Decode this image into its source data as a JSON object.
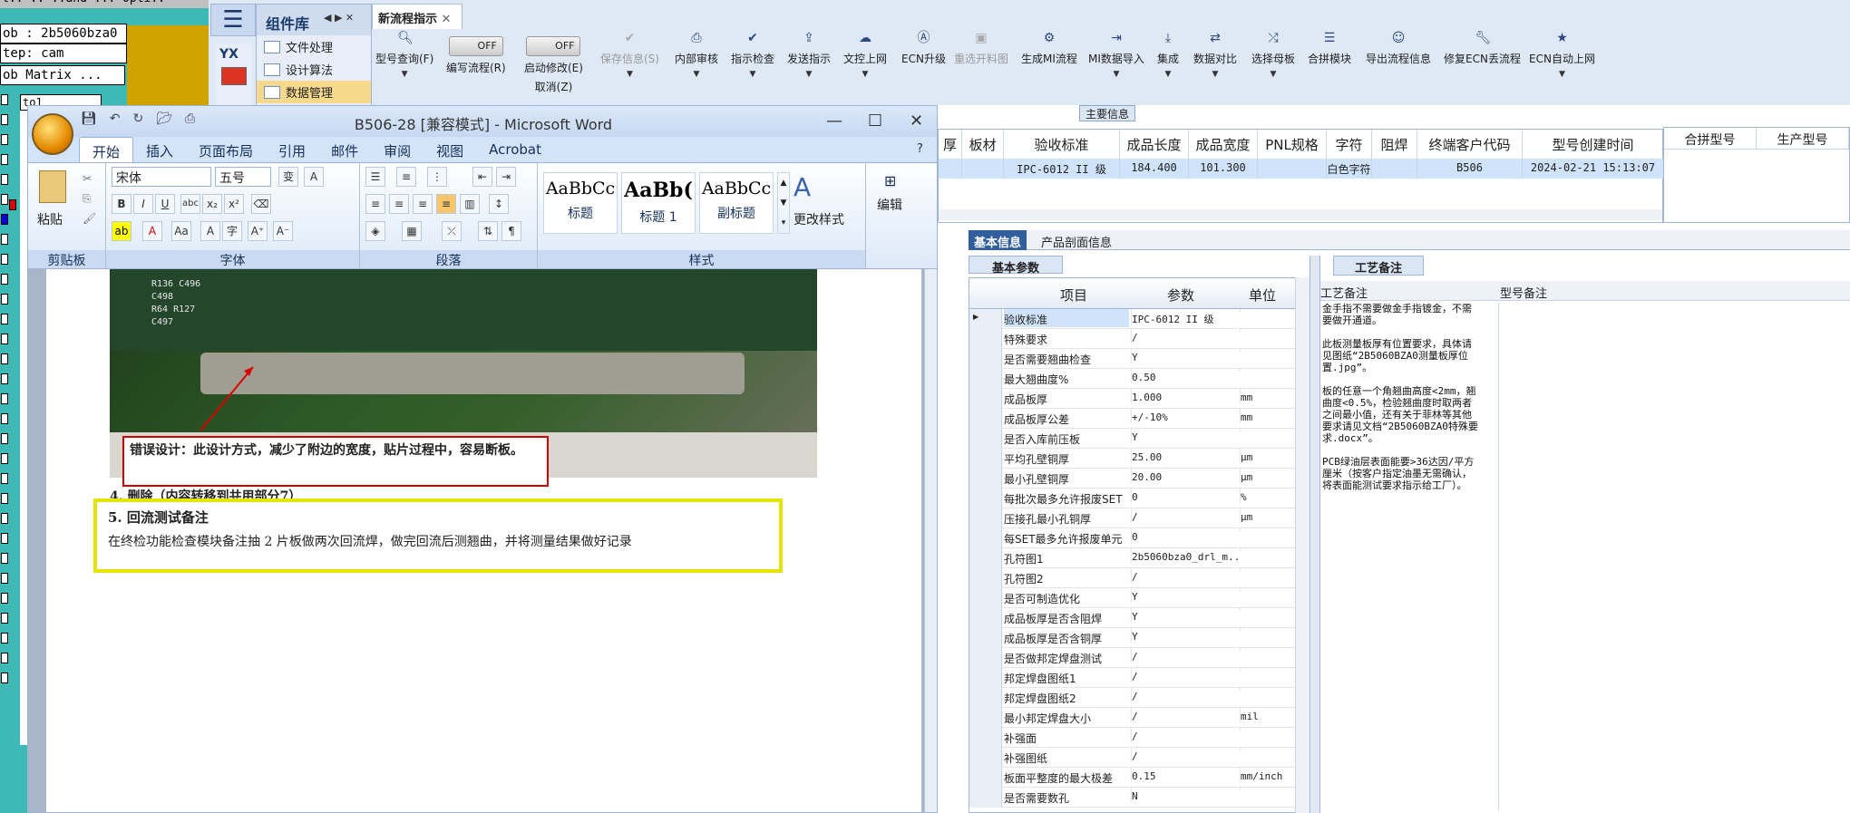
{
  "legacy": {
    "menu_text": "l.. .. ..and ... Opti..",
    "job_line": "ob : 2b5060bza0",
    "step_line": "tep: cam",
    "matrix_label": "ob Matrix ...",
    "row_label": "to1"
  },
  "app": {
    "library_title": "组件库",
    "library_items": [
      "文件处理",
      "设计算法",
      "数据管理"
    ],
    "active_tab": "新流程指示",
    "toolbar": [
      {
        "label": "型号查询(F)",
        "icon": "search-icon"
      },
      {
        "label": "编写流程(R)",
        "toggle": "OFF"
      },
      {
        "label": "启动修改(E)",
        "sub": "取消(Z)",
        "toggle": "OFF"
      },
      {
        "label": "保存信息(S)",
        "icon": "check-icon",
        "disabled": true
      },
      {
        "label": "内部审核",
        "icon": "print-icon"
      },
      {
        "label": "指示检查",
        "icon": "check-icon"
      },
      {
        "label": "发送指示",
        "icon": "upload-icon"
      },
      {
        "label": "文控上网",
        "icon": "cloud-icon"
      },
      {
        "label": "ECN升级",
        "icon": "a-icon"
      },
      {
        "label": "重选开料图",
        "icon": "image-icon",
        "disabled": true
      },
      {
        "label": "生成MI流程",
        "icon": "gears-icon"
      },
      {
        "label": "MI数据导入",
        "icon": "import-icon"
      },
      {
        "label": "集成",
        "icon": "download-icon"
      },
      {
        "label": "数据对比",
        "icon": "compare-icon"
      },
      {
        "label": "选择母板",
        "icon": "shuffle-icon"
      },
      {
        "label": "合拼模块",
        "icon": "list-icon"
      },
      {
        "label": "导出流程信息",
        "icon": "smile-icon"
      },
      {
        "label": "修复ECN丢流程",
        "icon": "wrench-icon"
      },
      {
        "label": "ECN自动上网",
        "icon": "star-icon"
      }
    ]
  },
  "word": {
    "title": "B506-28 [兼容模式] - Microsoft Word",
    "tabs": [
      "开始",
      "插入",
      "页面布局",
      "引用",
      "邮件",
      "审阅",
      "视图",
      "Acrobat"
    ],
    "font_name": "宋体",
    "font_size": "五号",
    "groups": [
      "剪贴板",
      "字体",
      "段落",
      "样式"
    ],
    "paste_label": "粘贴",
    "styles": [
      {
        "preview": "AaBbCc",
        "label": "标题"
      },
      {
        "preview": "AaBb(",
        "label": "标题 1"
      },
      {
        "preview": "AaBbCc",
        "label": "副标题"
      }
    ],
    "change_styles": "更改样式",
    "edit": "编辑",
    "photo_labels": [
      "R136 C496",
      "C498",
      "R64 R127",
      "C497"
    ],
    "error_note": "错误设计：此设计方式，减少了附边的宽度，贴片过程中，容易断板。",
    "deleted_line": "4. 删除（内容转移到共用部分7）",
    "section_heading": "5. 回流测试备注",
    "section_body": "在终检功能检查模块备注抽 2 片板做两次回流焊，做完回流后测翘曲，并将测量结果做好记录"
  },
  "main_info": {
    "label": "主要信息",
    "headers": [
      "厚",
      "板材",
      "验收标准",
      "成品长度",
      "成品宽度",
      "PNL规格",
      "字符",
      "阻焊",
      "终端客户代码",
      "型号创建时间"
    ],
    "row": [
      "",
      "",
      "IPC-6012 II 级",
      "184.400",
      "101.300",
      "",
      "白色字符",
      "",
      "B506",
      "2024-02-21 15:13:07"
    ],
    "side_headers": [
      "合拼型号",
      "生产型号"
    ]
  },
  "subtabs": [
    "基本信息",
    "产品剖面信息"
  ],
  "basic_params": {
    "title": "基本参数",
    "headers": [
      "项目",
      "参数",
      "单位"
    ],
    "rows": [
      [
        "验收标准",
        "IPC-6012 II 级",
        ""
      ],
      [
        "特殊要求",
        "/",
        ""
      ],
      [
        "是否需要翘曲检查",
        "Y",
        ""
      ],
      [
        "最大翘曲度%",
        "0.50",
        ""
      ],
      [
        "成品板厚",
        "1.000",
        "mm"
      ],
      [
        "成品板厚公差",
        "+/-10%",
        "mm"
      ],
      [
        "是否入库前压板",
        "Y",
        ""
      ],
      [
        "平均孔壁铜厚",
        "25.00",
        "μm"
      ],
      [
        "最小孔壁铜厚",
        "20.00",
        "μm"
      ],
      [
        "每批次最多允许报废SET",
        "0",
        "%"
      ],
      [
        "压接孔最小孔铜厚",
        "/",
        "μm"
      ],
      [
        "每SET最多允许报废单元",
        "0",
        ""
      ],
      [
        "孔符图1",
        "2b5060bza0_drl_m...",
        ""
      ],
      [
        "孔符图2",
        "/",
        ""
      ],
      [
        "是否可制造优化",
        "Y",
        ""
      ],
      [
        "成品板厚是否含阻焊",
        "Y",
        ""
      ],
      [
        "成品板厚是否含铜厚",
        "Y",
        ""
      ],
      [
        "是否做邦定焊盘测试",
        "/",
        ""
      ],
      [
        "邦定焊盘图纸1",
        "/",
        ""
      ],
      [
        "邦定焊盘图纸2",
        "/",
        ""
      ],
      [
        "最小邦定焊盘大小",
        "/",
        "mil"
      ],
      [
        "补强面",
        "/",
        ""
      ],
      [
        "补强图纸",
        "/",
        ""
      ],
      [
        "板面平整度的最大极差",
        "0.15",
        "mm/inch"
      ],
      [
        "是否需要数孔",
        "N",
        ""
      ]
    ]
  },
  "process": {
    "tab": "工艺备注",
    "col1": "工艺备注",
    "col2": "型号备注",
    "text": "金手指不需要做金手指镀金，不需要做开通道。\n\n此板测量板厚有位置要求，具体请见图纸“2B5060BZA0测量板厚位置.jpg”。\n\n板的任意一个角翘曲高度<2mm，翘曲度<0.5%，检验翘曲度时取两者之间最小值，还有关于菲林等其他要求请见文档“2B5060BZA0特殊要求.docx”。\n\nPCB绿油层表面能要>36达因/平方厘米（按客户指定油墨无需确认，将表面能测试要求指示给工厂）。"
  }
}
